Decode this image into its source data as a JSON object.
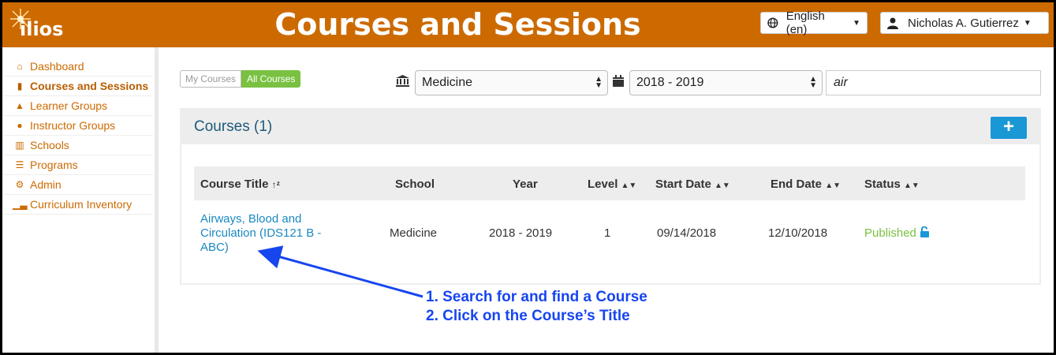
{
  "header": {
    "logo": "ilios",
    "title": "Courses and Sessions",
    "language": "English (en)",
    "user": "Nicholas A. Gutierrez"
  },
  "sidebar": {
    "items": [
      {
        "label": "Dashboard",
        "icon": "home-icon"
      },
      {
        "label": "Courses and Sessions",
        "icon": "book-icon",
        "active": true
      },
      {
        "label": "Learner Groups",
        "icon": "graduation-cap-icon"
      },
      {
        "label": "Instructor Groups",
        "icon": "user-icon"
      },
      {
        "label": "Schools",
        "icon": "institution-icon"
      },
      {
        "label": "Programs",
        "icon": "list-icon"
      },
      {
        "label": "Admin",
        "icon": "gears-icon"
      },
      {
        "label": "Curriculum Inventory",
        "icon": "chart-icon"
      }
    ]
  },
  "filters": {
    "my_courses": "My Courses",
    "all_courses": "All Courses",
    "school": "Medicine",
    "year": "2018 - 2019",
    "search": "air"
  },
  "panel": {
    "title": "Courses (1)",
    "add_label": "+"
  },
  "table": {
    "headers": [
      "Course Title",
      "School",
      "Year",
      "Level",
      "Start Date",
      "End Date",
      "Status"
    ],
    "rows": [
      {
        "title": "Airways, Blood and Circulation (IDS121 B - ABC)",
        "school": "Medicine",
        "year": "2018 - 2019",
        "level": "1",
        "start": "09/14/2018",
        "end": "12/10/2018",
        "status": "Published"
      }
    ]
  },
  "annotation": {
    "line1": "1. Search for and find a Course",
    "line2": "2. Click on the Course’s Title",
    "color": "#1746ef"
  },
  "colors": {
    "brand": "#cc6a00",
    "link": "#1a89c0",
    "published": "#7ac142",
    "add_button": "#1a97d5"
  }
}
